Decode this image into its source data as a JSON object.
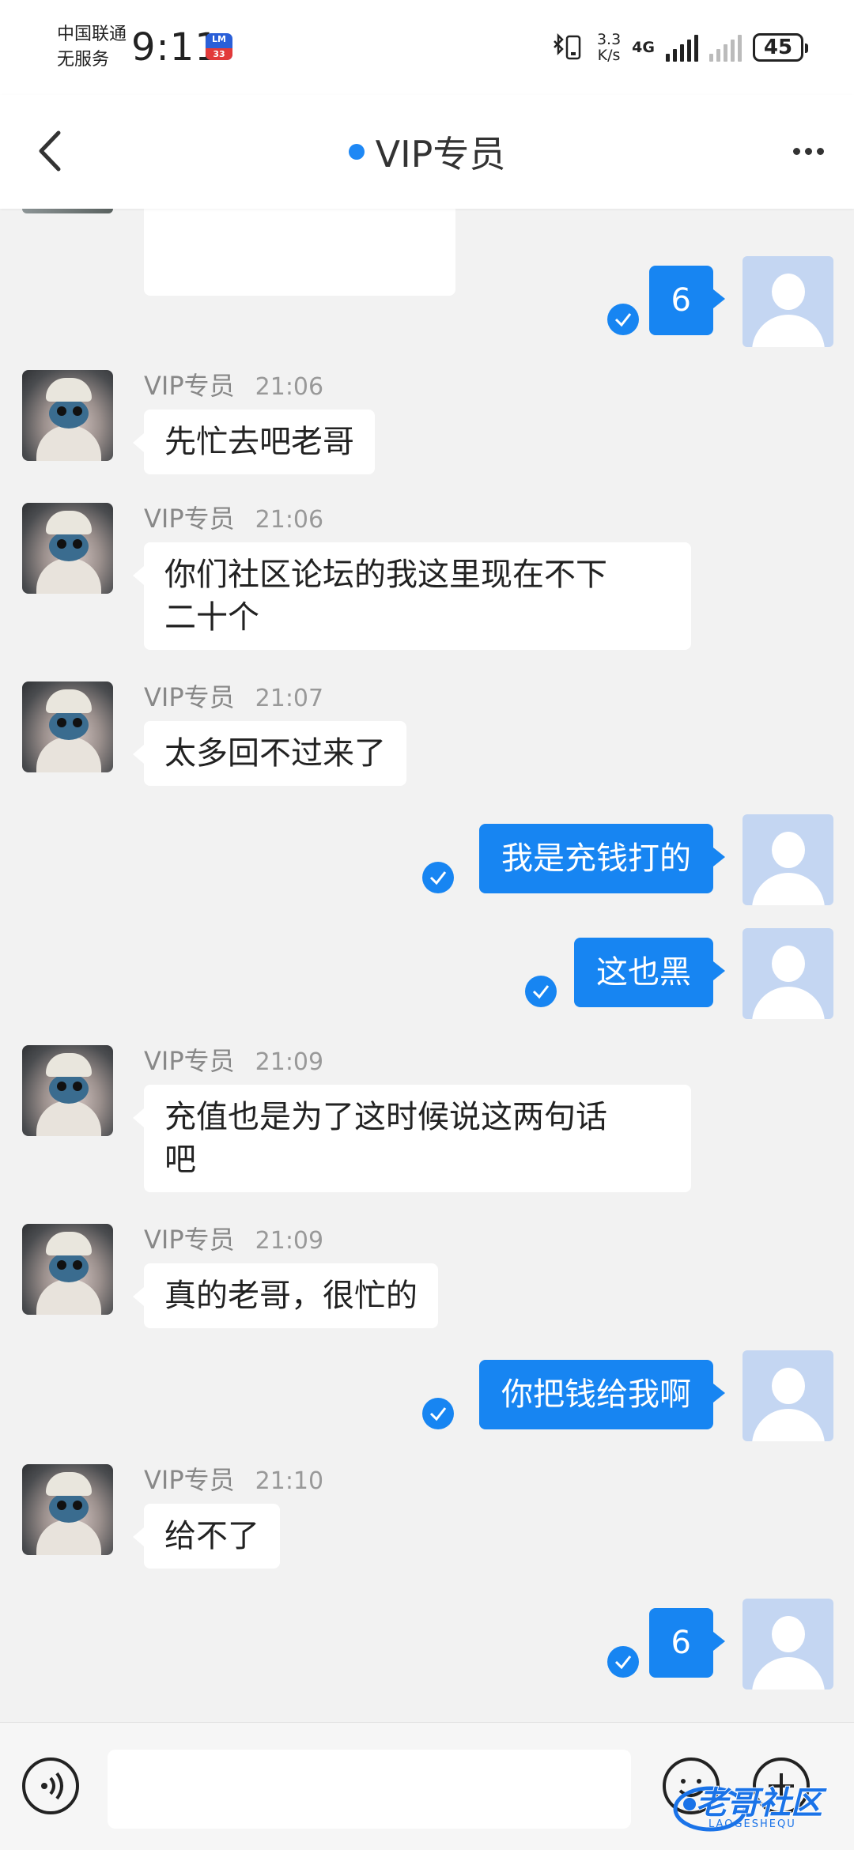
{
  "status_bar": {
    "carrier_line1": "中国联通",
    "carrier_line2": "无服务",
    "time": "9:11",
    "app_badge_top": "LM",
    "app_badge_bottom": "33",
    "net_speed_value": "3.3",
    "net_speed_unit": "K/s",
    "net_type": "4G",
    "battery": "45"
  },
  "header": {
    "title": "VIP专员",
    "online_color": "#1e88f5"
  },
  "colors": {
    "outgoing_bubble": "#1785f2",
    "incoming_bubble": "#ffffff",
    "background": "#f2f2f2"
  },
  "messages": [
    {
      "direction": "out",
      "text": "6",
      "read": true
    },
    {
      "direction": "in",
      "sender": "VIP专员",
      "time": "21:06",
      "text": "先忙去吧老哥"
    },
    {
      "direction": "in",
      "sender": "VIP专员",
      "time": "21:06",
      "text_lines": [
        "你们社区论坛的我这里现在不下",
        "二十个"
      ]
    },
    {
      "direction": "in",
      "sender": "VIP专员",
      "time": "21:07",
      "text": "太多回不过来了"
    },
    {
      "direction": "out",
      "text": "我是充钱打的",
      "read": true
    },
    {
      "direction": "out",
      "text": "这也黑",
      "read": true
    },
    {
      "direction": "in",
      "sender": "VIP专员",
      "time": "21:09",
      "text_lines": [
        "充值也是为了这时候说这两句话",
        "吧"
      ]
    },
    {
      "direction": "in",
      "sender": "VIP专员",
      "time": "21:09",
      "text": "真的老哥，很忙的"
    },
    {
      "direction": "out",
      "text": "你把钱给我啊",
      "read": true
    },
    {
      "direction": "in",
      "sender": "VIP专员",
      "time": "21:10",
      "text": "给不了"
    },
    {
      "direction": "out",
      "text": "6",
      "read": true
    }
  ],
  "input_bar": {
    "placeholder": "",
    "icons": [
      "voice-icon",
      "emoji-icon",
      "plus-icon"
    ]
  },
  "watermark": {
    "text": "老哥社区",
    "sub": "LAOGESHEQU"
  }
}
